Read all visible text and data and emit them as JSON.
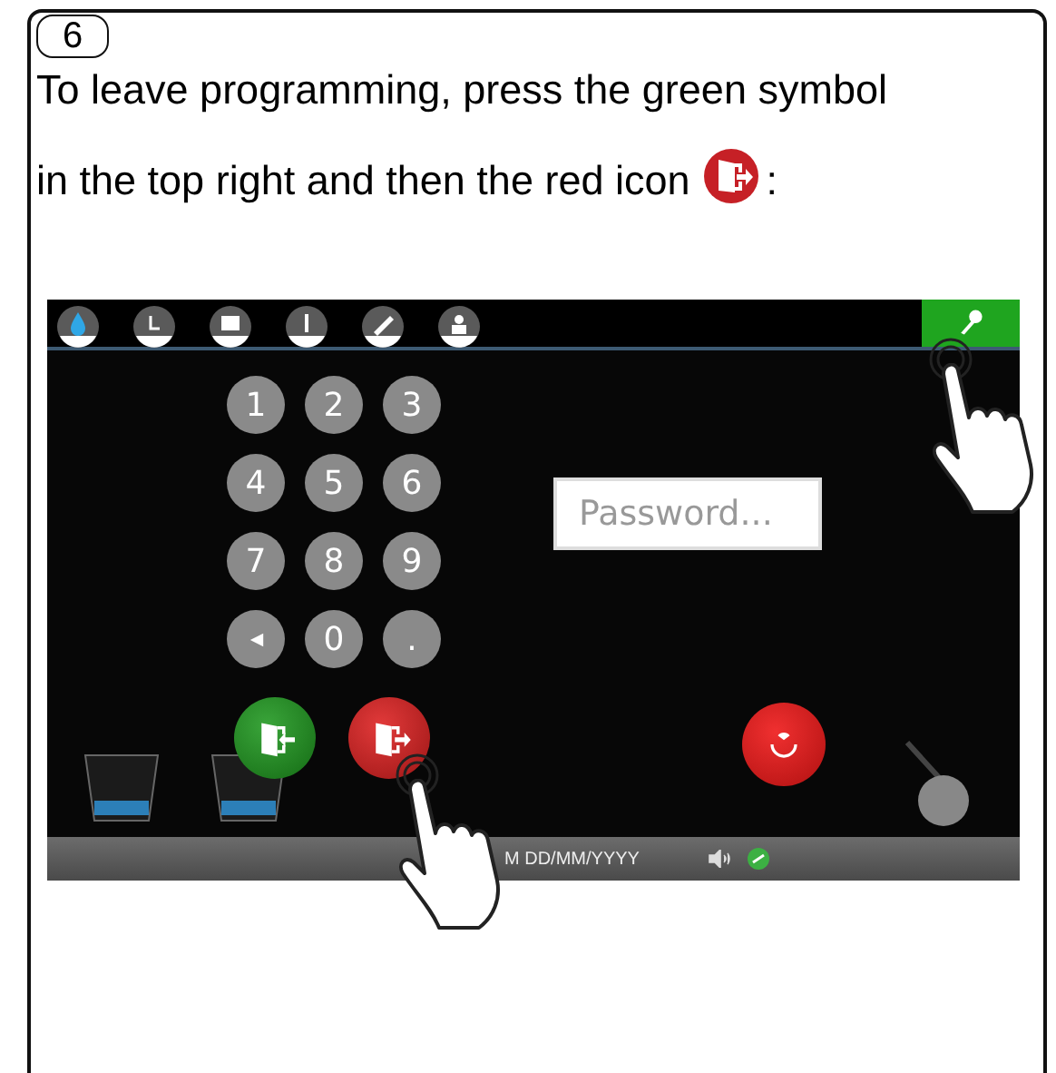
{
  "step": "6",
  "instruction_lines": [
    "To leave programming, press the green symbol",
    "in the top right and then the red icon"
  ],
  "instruction_end": ":",
  "screen": {
    "keys": [
      {
        "kind": "digit",
        "label": "1"
      },
      {
        "kind": "digit",
        "label": "2"
      },
      {
        "kind": "digit",
        "label": "3"
      },
      {
        "kind": "digit",
        "label": "4"
      },
      {
        "kind": "digit",
        "label": "5"
      },
      {
        "kind": "digit",
        "label": "6"
      },
      {
        "kind": "digit",
        "label": "7"
      },
      {
        "kind": "digit",
        "label": "8"
      },
      {
        "kind": "digit",
        "label": "9"
      },
      {
        "kind": "backspace"
      },
      {
        "kind": "digit",
        "label": "0"
      },
      {
        "kind": "digit",
        "label": "."
      }
    ],
    "password": {
      "placeholder": "Password..."
    },
    "status_bar": {
      "datetime": "M DD/MM/YYYY"
    }
  }
}
